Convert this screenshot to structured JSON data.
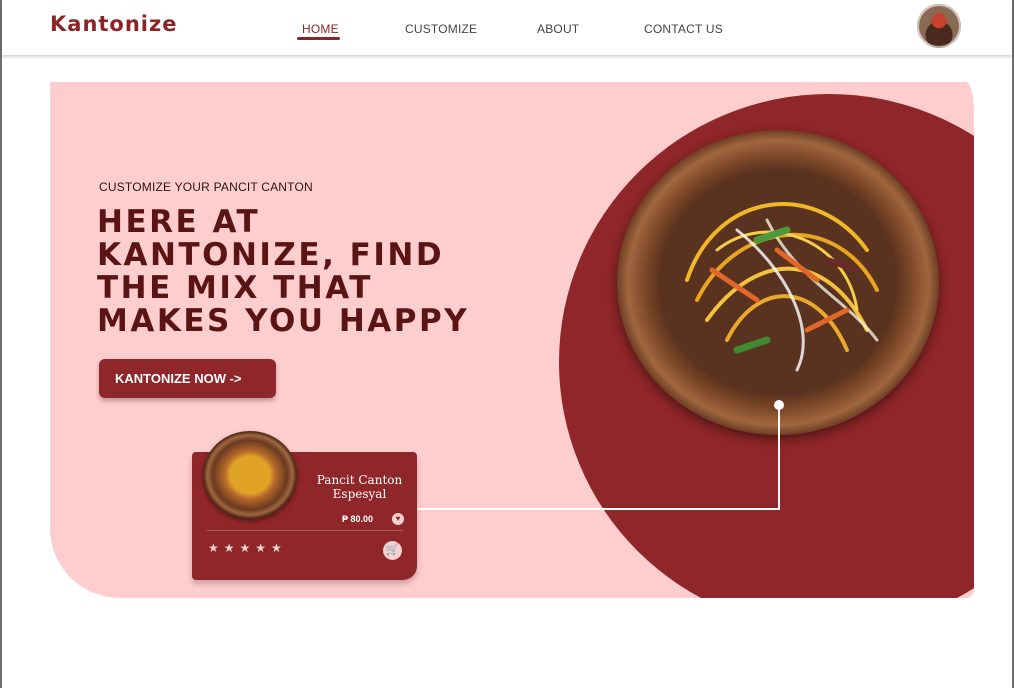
{
  "nav": {
    "logo": "Kantonize",
    "links": [
      "HOME",
      "CUSTOMIZE",
      "ABOUT",
      "CONTACT US"
    ],
    "active_link": "HOME"
  },
  "hero": {
    "eyebrow": "CUSTOMIZE YOUR PANCIT CANTON",
    "headline_lines": [
      "HERE AT",
      "KANTONIZE, FIND",
      "THE MIX THAT",
      "MAKES YOU HAPPY"
    ],
    "cta_label": "KANTONIZE NOW ->"
  },
  "product_card": {
    "title_line1": "Pancit Canton",
    "title_line2": "Espesyal",
    "price": "₱ 80.00",
    "rating_stars": 5,
    "stars_text": "★★★★★"
  },
  "icons": {
    "heart": "heart-icon",
    "cart": "cart-icon",
    "avatar": "user-avatar"
  },
  "colors": {
    "brand": "#8f2629",
    "hero_bg": "#fecdcd",
    "headline": "#5a1414"
  }
}
